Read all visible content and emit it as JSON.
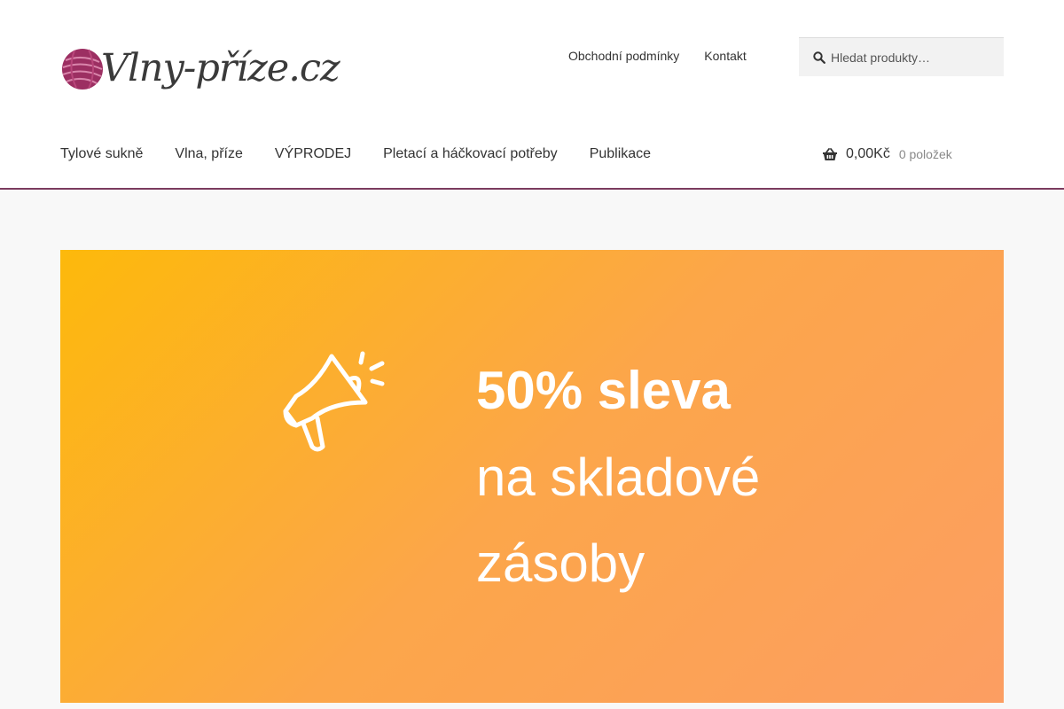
{
  "logo": {
    "text": "Vlny-příze.cz",
    "icon": "yarn-ball-icon"
  },
  "secondary_nav": {
    "items": [
      "Obchodní podmínky",
      "Kontakt"
    ]
  },
  "search": {
    "placeholder": "Hledat produkty…",
    "icon": "search-icon"
  },
  "main_nav": {
    "items": [
      "Tylové sukně",
      "Vlna, příze",
      "VÝPRODEJ",
      "Pletací a háčkovací potřeby",
      "Publikace"
    ]
  },
  "cart": {
    "amount": "0,00Kč",
    "count": "0 položek",
    "icon": "shopping-basket-icon"
  },
  "banner": {
    "headline": "50% sleva",
    "line2": "na skladové",
    "line3": "zásoby",
    "icon": "megaphone-icon"
  },
  "colors": {
    "accent": "#7b3b5e",
    "logo_ball": "#9c2f62",
    "banner_start": "#fdb90b",
    "banner_end": "#fc9e62",
    "banner_text": "#ffffff"
  }
}
